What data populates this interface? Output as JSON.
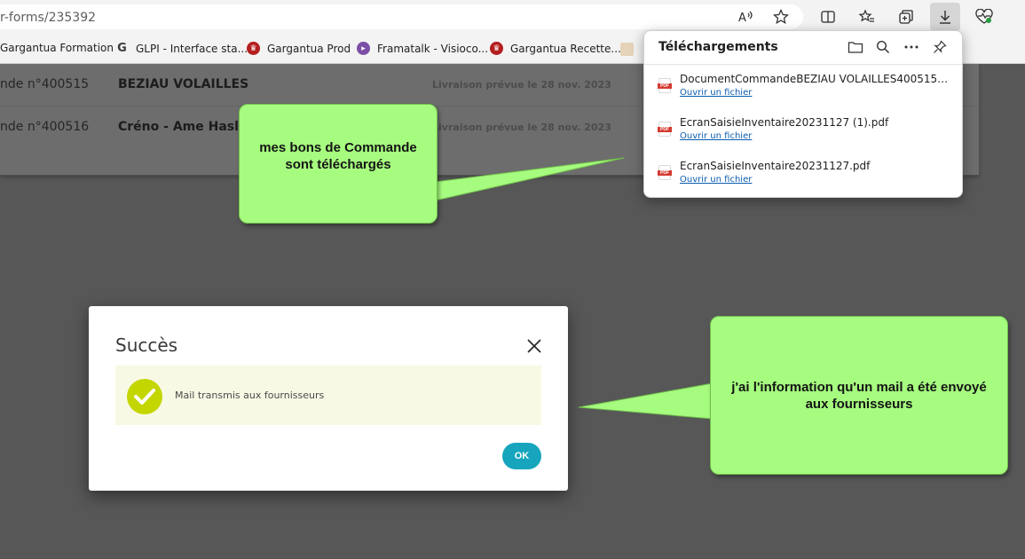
{
  "browser": {
    "url_fragment": "r-forms/235392",
    "bookmarks": [
      {
        "label": "Gargantua Formation",
        "icon": "gargantua-icon",
        "color": "#b41e1e"
      },
      {
        "label": "GLPI - Interface sta...",
        "icon": "glpi-icon",
        "color": "#3a3a3a"
      },
      {
        "label": "Gargantua Prod",
        "icon": "gargantua-icon",
        "color": "#b41e1e"
      },
      {
        "label": "Framatalk - Visioco...",
        "icon": "video-icon",
        "color": "#7b4fa6"
      },
      {
        "label": "Gargantua Recette...",
        "icon": "gargantua-icon",
        "color": "#b41e1e"
      }
    ]
  },
  "orders": [
    {
      "number": "nde n°400515",
      "supplier": "BEZIAU VOLAILLES",
      "delivery": "Livraison prévue le 28 nov. 2023"
    },
    {
      "number": "nde n°400516",
      "supplier": "Créno - Ame Hasle",
      "delivery": "Livraison prévue le 28 nov. 2023"
    }
  ],
  "downloads": {
    "title": "Téléchargements",
    "items": [
      {
        "name": "DocumentCommandeBEZIAU VOLAILLES400515-20231...",
        "action": "Ouvrir un fichier"
      },
      {
        "name": "EcranSaisieInventaire20231127 (1).pdf",
        "action": "Ouvrir un fichier"
      },
      {
        "name": "EcranSaisieInventaire20231127.pdf",
        "action": "Ouvrir un fichier"
      }
    ]
  },
  "callouts": {
    "downloads_note": "mes bons de Commande sont téléchargés",
    "mail_note": "j'ai l'information qu'un mail a été envoyé aux fournisseurs"
  },
  "modal": {
    "title": "Succès",
    "message": "Mail transmis aux fournisseurs",
    "ok_label": "OK"
  },
  "colors": {
    "callout": "#a6fc7f",
    "success_check": "#c4d600",
    "ok_button": "#16a5bd",
    "message_bg": "#f8f9e4"
  }
}
